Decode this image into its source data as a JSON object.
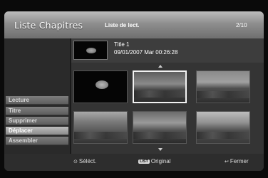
{
  "header": {
    "title": "Liste Chapitres",
    "subtitle": "Liste de lect.",
    "page_count": "2/10"
  },
  "menu": [
    {
      "label": "Lecture",
      "active": false
    },
    {
      "label": "Titre",
      "active": false
    },
    {
      "label": "Supprimer",
      "active": false
    },
    {
      "label": "Déplacer",
      "active": true
    },
    {
      "label": "Assembler",
      "active": false
    }
  ],
  "info": {
    "title": "Title 1",
    "datetime": "09/01/2007  Mar  00:26:28"
  },
  "footer": {
    "select_label": "Séléct.",
    "list_badge": "LIST",
    "original_label": "Original",
    "close_label": "Fermer"
  },
  "colors": {
    "header_gradient_top": "#bdbdbd",
    "panel": "#343434",
    "selected_border": "#f2f2f2"
  }
}
